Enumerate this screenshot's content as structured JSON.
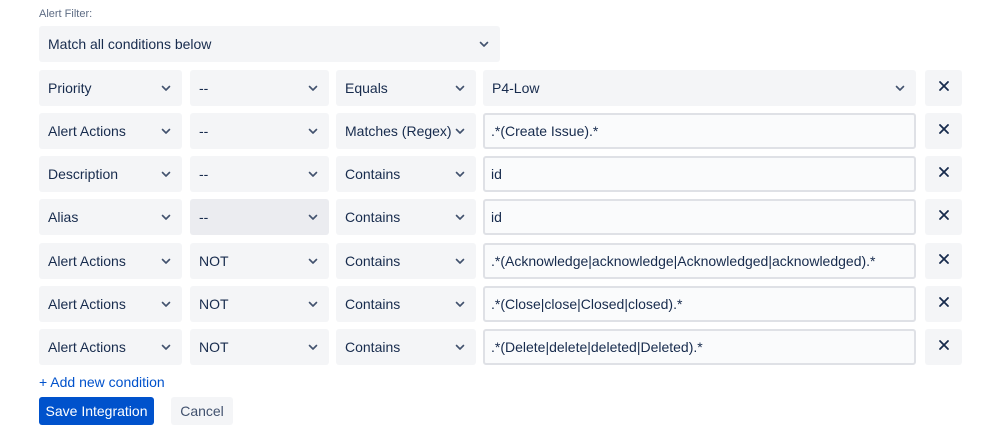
{
  "alert_filter": {
    "label": "Alert Filter:",
    "match_mode": "Match all conditions below"
  },
  "conditions": [
    {
      "field": "Priority",
      "not": "--",
      "operation": "Equals",
      "value": "P4-Low"
    },
    {
      "field": "Alert Actions",
      "not": "--",
      "operation": "Matches (Regex)",
      "value": ".*(Create Issue).*"
    },
    {
      "field": "Description",
      "not": "--",
      "operation": "Contains",
      "value": "id"
    },
    {
      "field": "Alias",
      "not": "--",
      "operation": "Contains",
      "value": "id"
    },
    {
      "field": "Alert Actions",
      "not": "NOT",
      "operation": "Contains",
      "value": ".*(Acknowledge|acknowledge|Acknowledged|acknowledged).*"
    },
    {
      "field": "Alert Actions",
      "not": "NOT",
      "operation": "Contains",
      "value": ".*(Close|close|Closed|closed).*"
    },
    {
      "field": "Alert Actions",
      "not": "NOT",
      "operation": "Contains",
      "value": ".*(Delete|delete|deleted|Deleted).*"
    }
  ],
  "actions": {
    "add_condition": "+ Add new condition",
    "save": "Save Integration",
    "cancel": "Cancel"
  },
  "icons": {
    "dropdown": "chevron-down-icon",
    "remove": "close-icon"
  },
  "colors": {
    "primary": "#0052cc",
    "field_bg": "#f4f5f7",
    "text": "#172b4d"
  }
}
